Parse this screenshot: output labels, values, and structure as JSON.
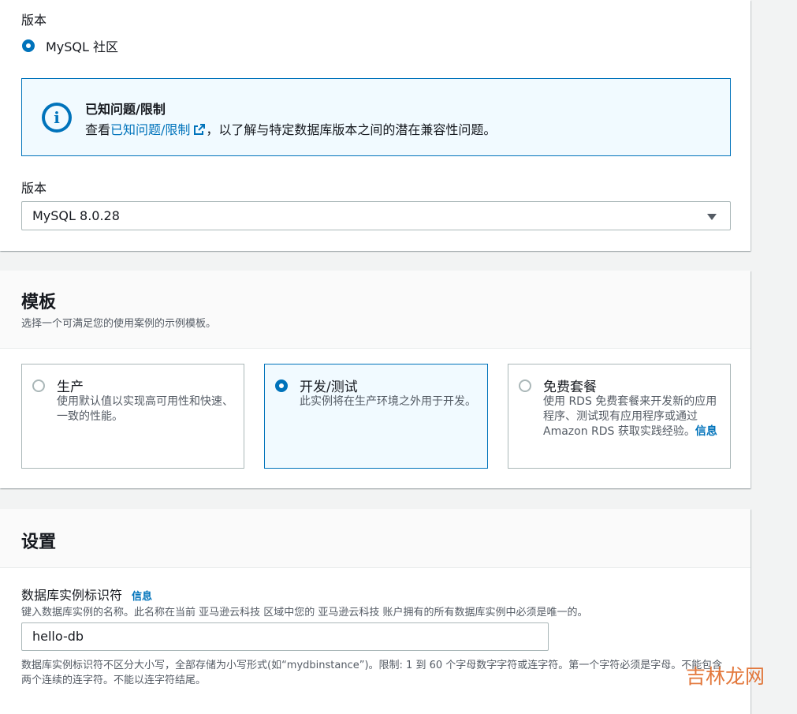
{
  "engine": {
    "edition_label": "版本",
    "edition_option": "MySQL 社区",
    "alert": {
      "title": "已知问题/限制",
      "body_prefix": "查看",
      "link_text": "已知问题/限制",
      "body_suffix": "，以了解与特定数据库版本之间的潜在兼容性问题。"
    },
    "version_label": "版本",
    "version_value": "MySQL 8.0.28"
  },
  "templates": {
    "title": "模板",
    "description": "选择一个可满足您的使用案例的示例模板。",
    "options": [
      {
        "name": "生产",
        "desc": "使用默认值以实现高可用性和快速、一致的性能。",
        "selected": false
      },
      {
        "name": "开发/测试",
        "desc": "此实例将在生产环境之外用于开发。",
        "selected": true
      },
      {
        "name": "免费套餐",
        "desc": "使用 RDS 免费套餐来开发新的应用程序、测试现有应用程序或通过 Amazon RDS 获取实践经验。",
        "info": "信息",
        "selected": false
      }
    ]
  },
  "settings": {
    "title": "设置",
    "identifier_label": "数据库实例标识符",
    "info_link": "信息",
    "identifier_desc": "键入数据库实例的名称。此名称在当前 亚马逊云科技 区域中您的 亚马逊云科技 账户拥有的所有数据库实例中必须是唯一的。",
    "identifier_value": "hello-db",
    "constraint": "数据库实例标识符不区分大小写，全部存储为小写形式(如“mydbinstance”)。限制: 1 到 60 个字母数字字符或连字符。第一个字符必须是字母。不能包含两个连续的连字符。不能以连字符结尾。"
  },
  "watermark": "吉林龙网",
  "colors": {
    "accent": "#0073bb",
    "selected_tile_bg": "#f1faff",
    "border": "#aab7b8"
  }
}
